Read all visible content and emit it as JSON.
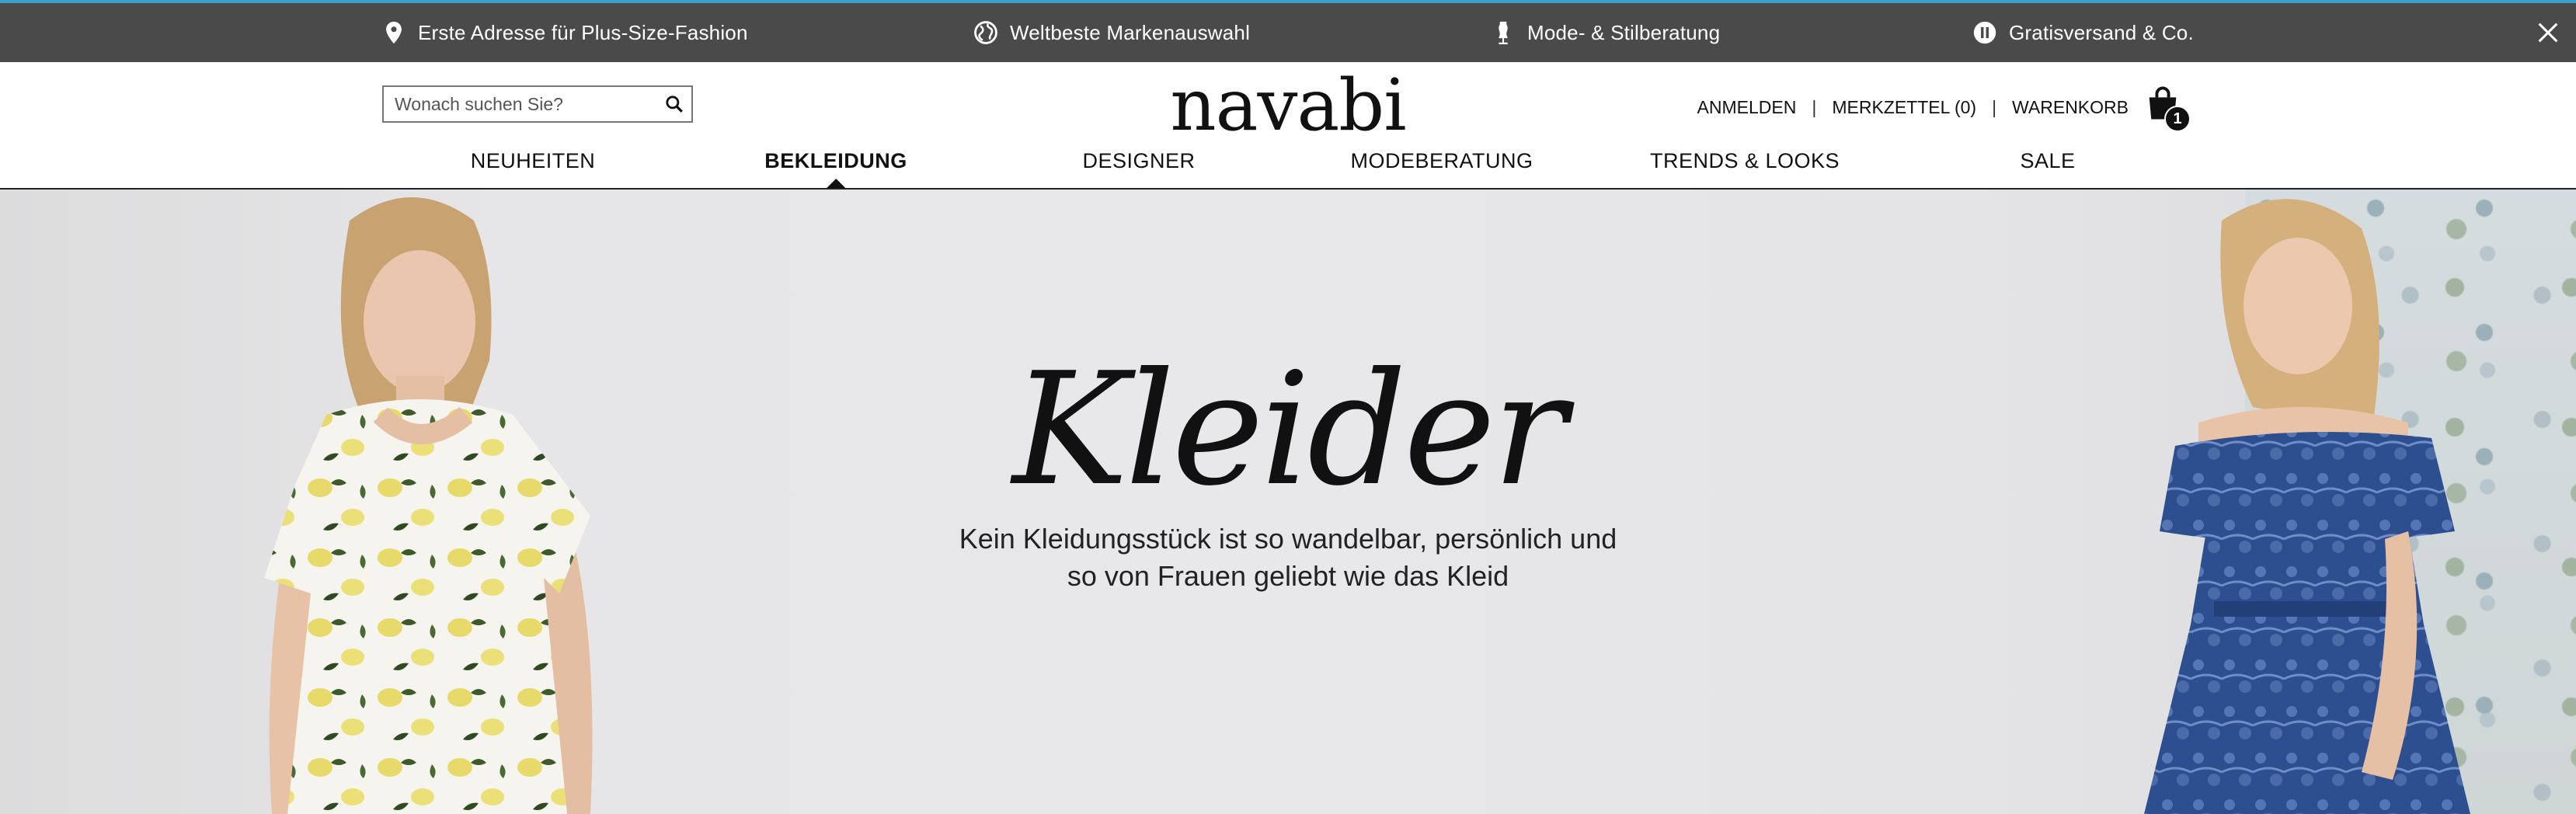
{
  "promo_bar": {
    "items": [
      {
        "icon": "map-pin-icon",
        "label": "Erste Adresse für Plus-Size-Fashion"
      },
      {
        "icon": "globe-icon",
        "label": "Weltbeste Markenauswahl"
      },
      {
        "icon": "dress-form-icon",
        "label": "Mode- & Stilberatung"
      },
      {
        "icon": "pause-circle-icon",
        "label": "Gratisversand & Co."
      }
    ],
    "close_icon": "close-icon",
    "background": "#4a4a4a",
    "accent": "#3aa0c8"
  },
  "header": {
    "logo": "navabi",
    "search": {
      "placeholder": "Wonach suchen Sie?",
      "value": ""
    },
    "account": {
      "login": "ANMELDEN",
      "separator": "|",
      "wishlist": "MERKZETTEL (0)",
      "cart": "WARENKORB",
      "cart_count": "1"
    }
  },
  "nav": {
    "items": [
      {
        "label": "NEUHEITEN",
        "active": false
      },
      {
        "label": "BEKLEIDUNG",
        "active": true
      },
      {
        "label": "DESIGNER",
        "active": false
      },
      {
        "label": "MODEBERATUNG",
        "active": false
      },
      {
        "label": "TRENDS & LOOKS",
        "active": false
      },
      {
        "label": "SALE",
        "active": false
      }
    ]
  },
  "hero": {
    "title": "Kleider",
    "subtitle_line1": "Kein Kleidungsstück ist so wandelbar, persönlich und",
    "subtitle_line2": "so von Frauen geliebt wie das Kleid"
  }
}
